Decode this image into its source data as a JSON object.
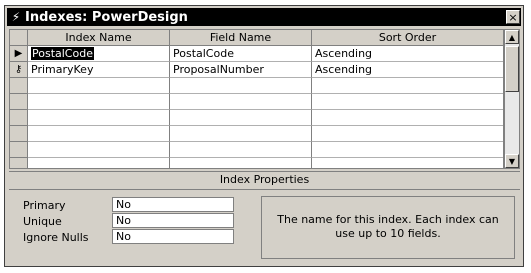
{
  "window": {
    "title": "Indexes: PowerDesign",
    "close_label": "×"
  },
  "grid": {
    "columns": [
      "Index Name",
      "Field Name",
      "Sort Order"
    ],
    "rows": [
      {
        "index_name": "PostalCode",
        "field_name": "PostalCode",
        "sort_order": "Ascending"
      },
      {
        "index_name": "PrimaryKey",
        "field_name": "ProposalNumber",
        "sort_order": "Ascending"
      }
    ],
    "current_row_glyph": "▶",
    "key_glyph": "⚷"
  },
  "scroll": {
    "up": "▲",
    "down": "▼"
  },
  "properties": {
    "header": "Index Properties",
    "primary_label": "Primary",
    "primary_value": "No",
    "unique_label": "Unique",
    "unique_value": "No",
    "ignore_nulls_label": "Ignore Nulls",
    "ignore_nulls_value": "No",
    "help_text": "The name for this index.  Each index can use up to 10 fields."
  },
  "icons": {
    "title_icon": "lightning-icon"
  }
}
